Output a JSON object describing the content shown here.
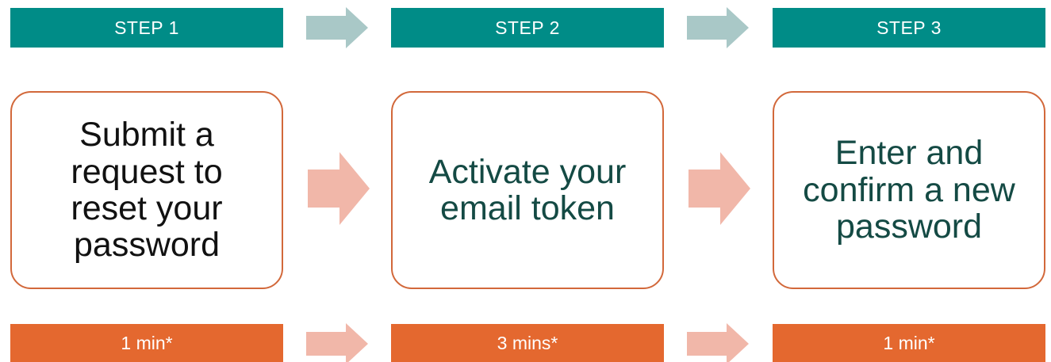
{
  "steps": [
    {
      "header": "STEP 1",
      "text": "Submit a request to reset your password",
      "time": "1 min*"
    },
    {
      "header": "STEP 2",
      "text": "Activate your email token",
      "time": "3 mins*"
    },
    {
      "header": "STEP 3",
      "text": "Enter and confirm a new password",
      "time": "1 min*"
    }
  ],
  "colors": {
    "header_bg": "#008C87",
    "footer_bg": "#E4682F",
    "card_border": "#D2683A",
    "header_arrow": "#A9C8C7",
    "body_arrow": "#F1B7A9"
  },
  "icons": {
    "connector": "right-arrow-icon"
  }
}
